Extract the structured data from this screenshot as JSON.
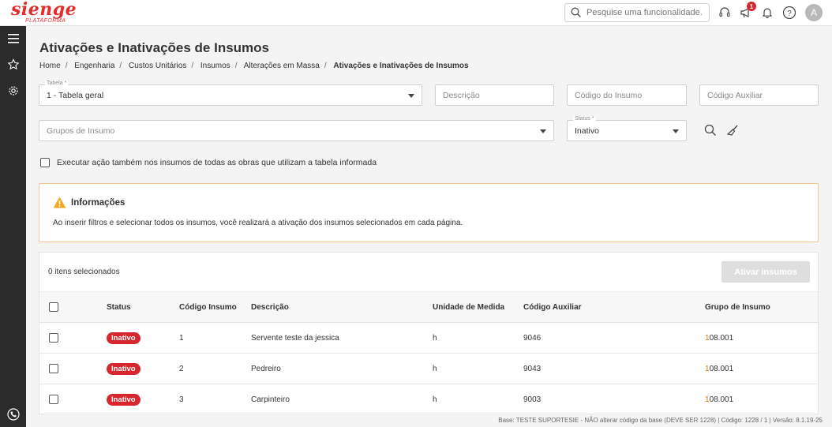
{
  "brand": {
    "logo": "sienge",
    "sub": "PLATAFORMA",
    "color": "#e42c2c"
  },
  "header": {
    "search_placeholder": "Pesquise uma funcionalidade.",
    "notification_count": "1",
    "avatar_initial": "A"
  },
  "page": {
    "title": "Ativações e Inativações de Insumos",
    "breadcrumb": [
      "Home",
      "Engenharia",
      "Custos Unitários",
      "Insumos",
      "Alterações em Massa",
      "Ativações e Inativações de Insumos"
    ]
  },
  "filters": {
    "tabela_label": "Tabela *",
    "tabela_value": "1 - Tabela geral",
    "descricao_placeholder": "Descrição",
    "codigo_insumo_placeholder": "Código do Insumo",
    "codigo_auxiliar_placeholder": "Código Auxiliar",
    "grupos_placeholder": "Grupos de Insumo",
    "status_label": "Status *",
    "status_value": "Inativo",
    "executar_label": "Executar ação também nos insumos de todas as obras que utilizam a tabela informada"
  },
  "info": {
    "title": "Informações",
    "text": "Ao inserir filtros e selecionar todos os insumos, você realizará a ativação dos insumos selecionados em cada página."
  },
  "table": {
    "selected_count": "0 itens selecionados",
    "action_button": "Ativar insumos",
    "columns": [
      "Status",
      "Código Insumo",
      "Descrição",
      "Unidade de Medida",
      "Código Auxiliar",
      "Grupo de Insumo"
    ],
    "rows": [
      {
        "status": "Inativo",
        "codigo": "1",
        "descricao": "Servente teste da jessica",
        "unidade": "h",
        "auxiliar": "9046",
        "grupo_first": "1",
        "grupo_rest": "08.001"
      },
      {
        "status": "Inativo",
        "codigo": "2",
        "descricao": "Pedreiro",
        "unidade": "h",
        "auxiliar": "9043",
        "grupo_first": "1",
        "grupo_rest": "08.001"
      },
      {
        "status": "Inativo",
        "codigo": "3",
        "descricao": "Carpinteiro",
        "unidade": "h",
        "auxiliar": "9003",
        "grupo_first": "1",
        "grupo_rest": "08.001"
      }
    ]
  },
  "footer": {
    "text": "Base: TESTE SUPORTESIE - NÃO alterar código da base (DEVE SER 1228)  |  Código: 1228 / 1  |  Versão: 8.1.19-25"
  },
  "colors": {
    "status_badge": "#d8262e",
    "warning": "#f5a623",
    "sidebar": "#2b2b2b"
  }
}
